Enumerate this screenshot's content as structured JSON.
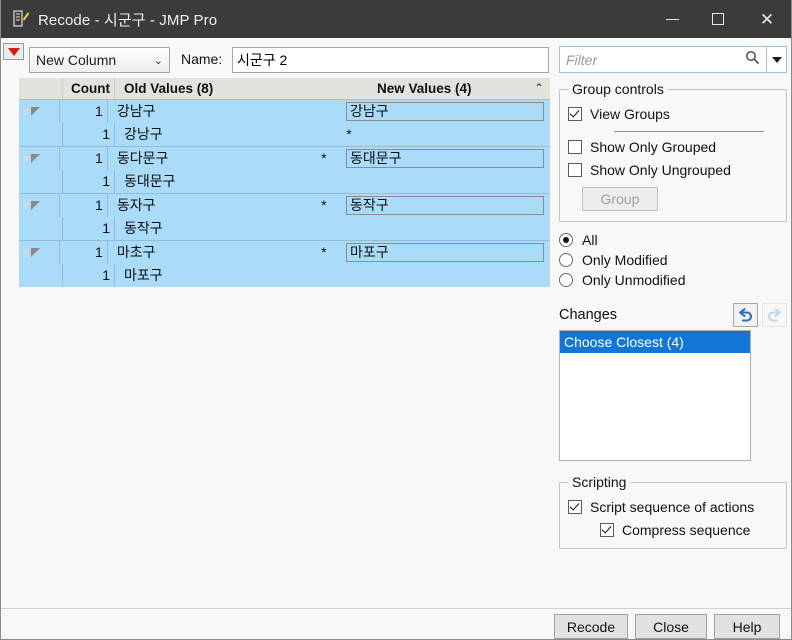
{
  "window": {
    "title": "Recode - 시군구 - JMP Pro",
    "icon": "recode-document-icon",
    "minimize_label": "—",
    "maximize_label": "□",
    "close_label": "✕"
  },
  "toolbar": {
    "menu_icon": "red-triangle-menu-icon",
    "column_mode": "New Column",
    "column_mode_chevron": "⌄",
    "name_label": "Name:",
    "name_value": "시군구 2"
  },
  "table": {
    "headers": {
      "expander": "",
      "count": "Count",
      "old_values": "Old Values (8)",
      "star": "",
      "new_values": "New Values (4)",
      "sort_chevron": "⌃"
    },
    "rows": [
      {
        "expander": true,
        "count": "1",
        "old_value": "강남구",
        "star": "",
        "new_value": "강남구"
      },
      {
        "expander": false,
        "count": "1",
        "old_value": "강낭구",
        "star": "*",
        "new_value": ""
      },
      {
        "expander": true,
        "count": "1",
        "old_value": "동다문구",
        "star": "*",
        "new_value": "동대문구"
      },
      {
        "expander": false,
        "count": "1",
        "old_value": "동대문구",
        "star": "",
        "new_value": ""
      },
      {
        "expander": true,
        "count": "1",
        "old_value": "동자구",
        "star": "*",
        "new_value": "동작구"
      },
      {
        "expander": false,
        "count": "1",
        "old_value": "동작구",
        "star": "",
        "new_value": ""
      },
      {
        "expander": true,
        "count": "1",
        "old_value": "마초구",
        "star": "*",
        "new_value": "마포구"
      },
      {
        "expander": false,
        "count": "1",
        "old_value": "마포구",
        "star": "",
        "new_value": ""
      }
    ],
    "row_highlight_color": "#aadcfa"
  },
  "filter": {
    "placeholder": "Filter",
    "value": "",
    "search_icon": "magnifier-icon",
    "dropdown_icon": "chevron-down-icon"
  },
  "group_controls": {
    "legend": "Group controls",
    "view_groups": {
      "label": "View Groups",
      "checked": true
    },
    "show_only_grouped": {
      "label": "Show Only Grouped",
      "checked": false
    },
    "show_only_ungrouped": {
      "label": "Show Only Ungrouped",
      "checked": false
    },
    "group_button": {
      "label": "Group",
      "enabled": false
    }
  },
  "view_filter_radios": {
    "selected": "All",
    "options": [
      {
        "label": "All",
        "selected": true
      },
      {
        "label": "Only Modified",
        "selected": false
      },
      {
        "label": "Only Unmodified",
        "selected": false
      }
    ]
  },
  "changes": {
    "title": "Changes",
    "undo_icon": "undo-arrow-icon",
    "redo_icon": "redo-arrow-icon",
    "undo_enabled": true,
    "redo_enabled": false,
    "items": [
      {
        "label": "Choose Closest (4)",
        "selected": true
      }
    ],
    "selected_color": "#1277d4"
  },
  "scripting": {
    "legend": "Scripting",
    "script_sequence": {
      "label": "Script sequence of actions",
      "checked": true
    },
    "compress_sequence": {
      "label": "Compress sequence",
      "checked": true
    }
  },
  "footer": {
    "recode": "Recode",
    "close": "Close",
    "help": "Help"
  }
}
